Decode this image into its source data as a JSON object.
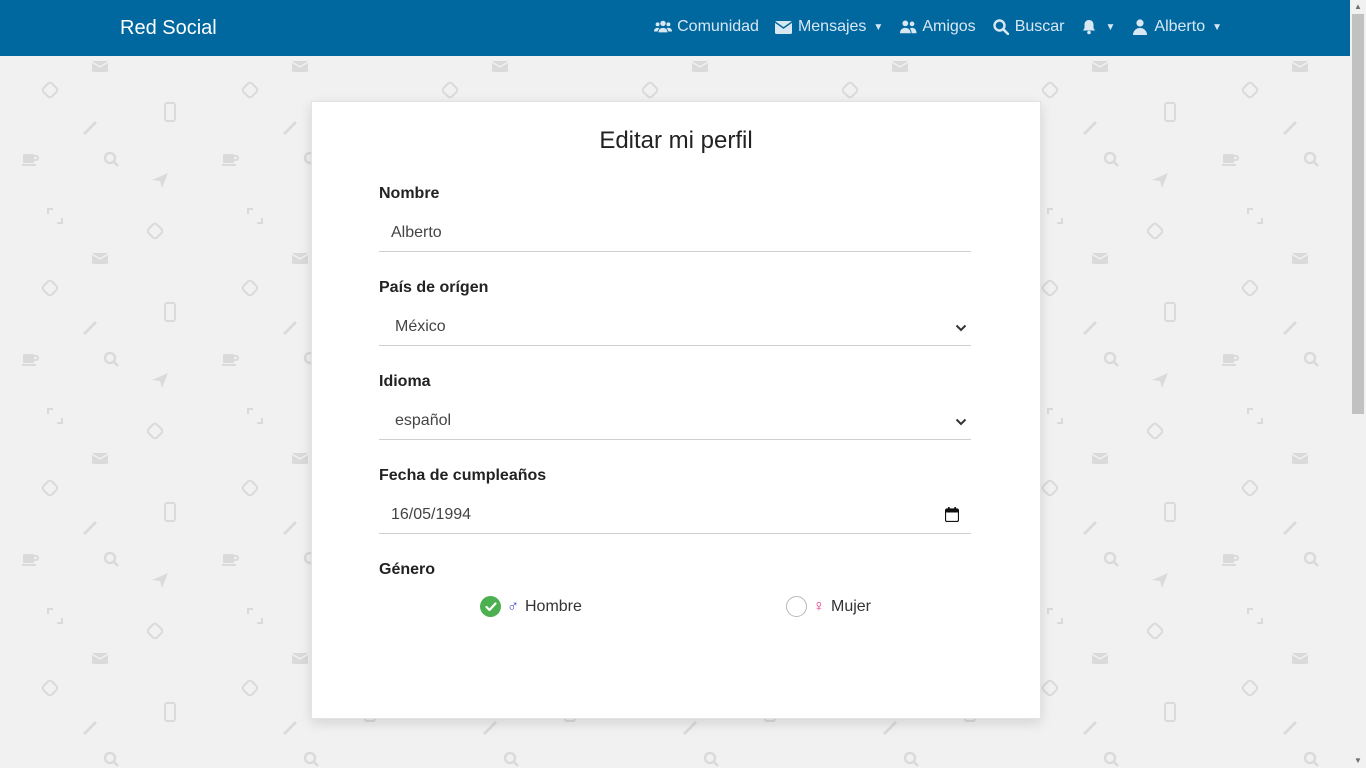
{
  "brand": "Red Social",
  "nav": {
    "comunidad": "Comunidad",
    "mensajes": "Mensajes",
    "amigos": "Amigos",
    "buscar": "Buscar",
    "user": "Alberto"
  },
  "form": {
    "title": "Editar mi perfil",
    "nombre_label": "Nombre",
    "nombre_value": "Alberto",
    "pais_label": "País de orígen",
    "pais_value": "México",
    "idioma_label": "Idioma",
    "idioma_value": "español",
    "fecha_label": "Fecha de cumpleaños",
    "fecha_value": "16/05/1994",
    "genero_label": "Género",
    "genero_options": [
      {
        "symbol": "♂",
        "label": "Hombre",
        "checked": true,
        "color": "#3a3fd0"
      },
      {
        "symbol": "♀",
        "label": "Mujer",
        "checked": false,
        "color": "#e0338a"
      }
    ]
  },
  "colors": {
    "navbar": "#01679f",
    "check": "#4caf50"
  },
  "icons": {
    "comunidad": "users-icon",
    "mensajes": "envelope-icon",
    "amigos": "user-friends-icon",
    "buscar": "search-icon",
    "notifications": "bell-icon",
    "user": "user-icon"
  }
}
